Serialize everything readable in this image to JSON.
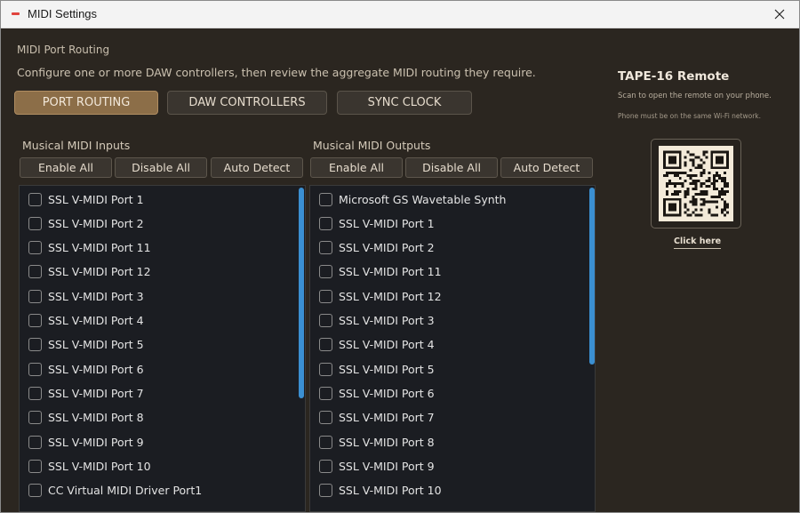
{
  "window": {
    "title": "MIDI Settings",
    "close_icon": "close-icon"
  },
  "header": {
    "section_title": "MIDI Port Routing",
    "description": "Configure one or more DAW controllers, then review the aggregate MIDI routing they require."
  },
  "tabs": [
    {
      "label": "PORT ROUTING",
      "active": true
    },
    {
      "label": "DAW CONTROLLERS",
      "active": false
    },
    {
      "label": "SYNC CLOCK",
      "active": false
    }
  ],
  "inputs": {
    "label": "Musical MIDI Inputs",
    "enable_all": "Enable All",
    "disable_all": "Disable All",
    "auto_detect": "Auto Detect",
    "items": [
      "SSL V-MIDI Port 1",
      "SSL V-MIDI Port 2",
      "SSL V-MIDI Port 11",
      "SSL V-MIDI Port 12",
      "SSL V-MIDI Port 3",
      "SSL V-MIDI Port 4",
      "SSL V-MIDI Port 5",
      "SSL V-MIDI Port 6",
      "SSL V-MIDI Port 7",
      "SSL V-MIDI Port 8",
      "SSL V-MIDI Port 9",
      "SSL V-MIDI Port 10",
      "CC Virtual MIDI Driver Port1"
    ]
  },
  "outputs": {
    "label": "Musical MIDI Outputs",
    "enable_all": "Enable All",
    "disable_all": "Disable All",
    "auto_detect": "Auto Detect",
    "items": [
      "Microsoft GS Wavetable Synth",
      "SSL V-MIDI Port 1",
      "SSL V-MIDI Port 2",
      "SSL V-MIDI Port 11",
      "SSL V-MIDI Port 12",
      "SSL V-MIDI Port 3",
      "SSL V-MIDI Port 4",
      "SSL V-MIDI Port 5",
      "SSL V-MIDI Port 6",
      "SSL V-MIDI Port 7",
      "SSL V-MIDI Port 8",
      "SSL V-MIDI Port 9",
      "SSL V-MIDI Port 10"
    ]
  },
  "remote": {
    "title": "TAPE-16 Remote",
    "description": "Scan to open the remote on your phone.",
    "note": "Phone must be on the same Wi-Fi network.",
    "qr_icon": "qr-code-icon",
    "link": "Click here"
  },
  "colors": {
    "accent": "#8c6e48",
    "scrollbar": "#3b8fd1",
    "background": "#2b2620",
    "list_background": "#1b1d22"
  }
}
